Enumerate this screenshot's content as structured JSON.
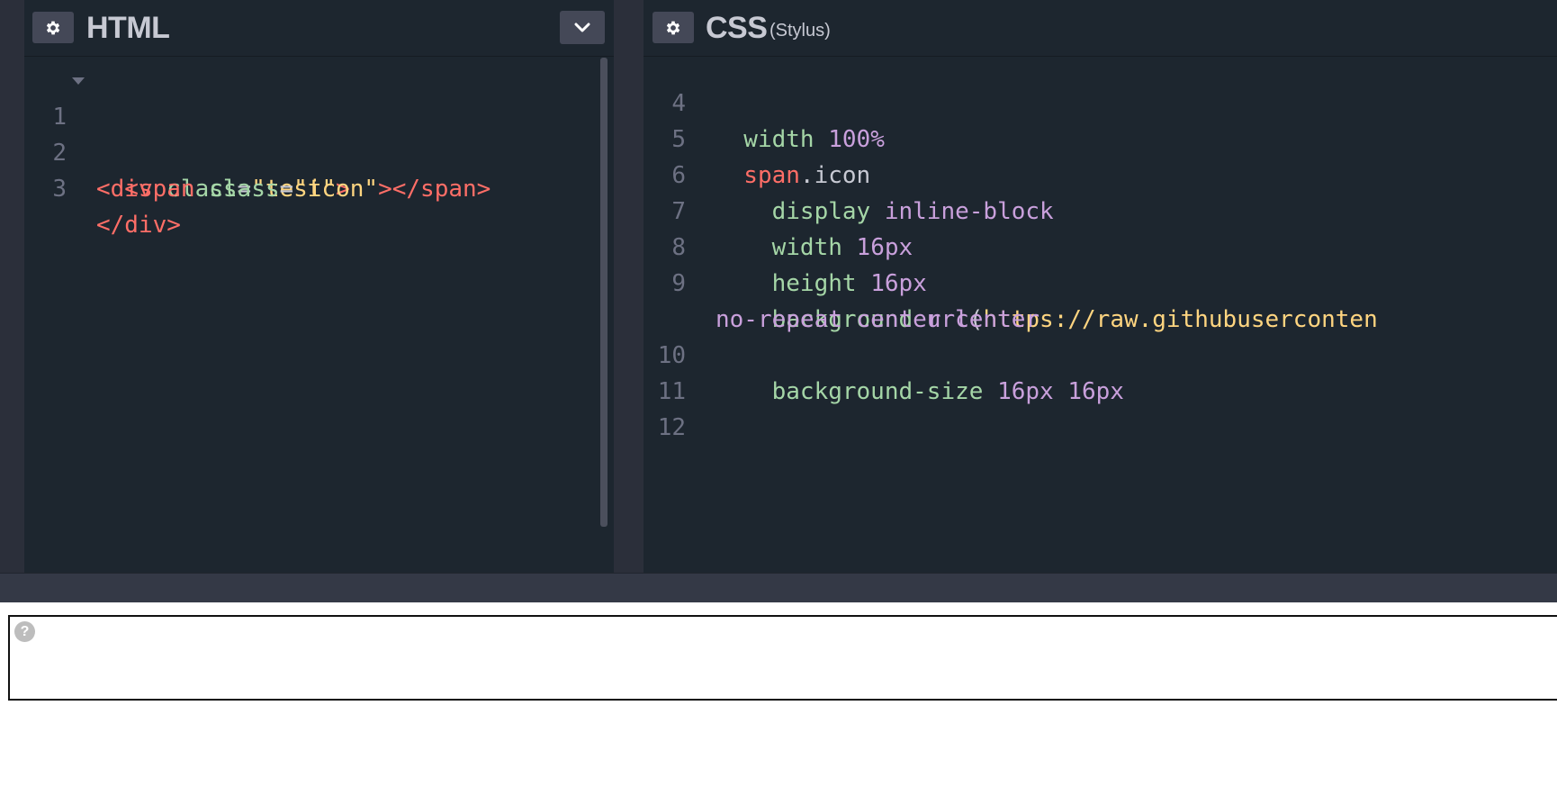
{
  "colors": {
    "editor_bg": "#1d262f",
    "chrome_bg": "#2b2f3a",
    "button_bg": "#444857",
    "tag": "#ff6e67",
    "attr": "#a5d6a7",
    "string": "#ffd580",
    "value": "#c9a0dc"
  },
  "html_pane": {
    "title": "HTML",
    "settings_icon": "gear-icon",
    "collapse_icon": "chevron-down-icon",
    "lines": [
      {
        "num": "1",
        "t1": "<div",
        "t2": " class",
        "t3": "=",
        "t4": "\"test\"",
        "t5": ">"
      },
      {
        "num": "2",
        "t1": "  <span",
        "t2": " class",
        "t3": "=",
        "t4": "\"icon\"",
        "t5": "></span>"
      },
      {
        "num": "3",
        "t1": "</div>"
      }
    ]
  },
  "css_pane": {
    "title": "CSS",
    "subtitle": "(Stylus)",
    "settings_icon": "gear-icon",
    "lines": [
      {
        "num": "4",
        "prop": "  width",
        "val": " 100%"
      },
      {
        "num": "5",
        "sel": "  span",
        "rest": ".icon"
      },
      {
        "num": "6",
        "prop": "    display",
        "val": " inline-block"
      },
      {
        "num": "7",
        "prop": "    width",
        "val": " 16px"
      },
      {
        "num": "8",
        "prop": "    height",
        "val": " 16px"
      },
      {
        "num": "9",
        "prop": "    background",
        "fn": " url",
        "paren": "(",
        "url": "https://raw.githubuserconten"
      },
      {
        "num": "",
        "wrap": "no-repeat center center"
      },
      {
        "num": "10",
        "prop": "    background-size",
        "val": " 16px 16px"
      },
      {
        "num": "11"
      },
      {
        "num": "12"
      }
    ]
  },
  "preview": {
    "help_icon": "question-circle-icon",
    "help_glyph": "?"
  }
}
